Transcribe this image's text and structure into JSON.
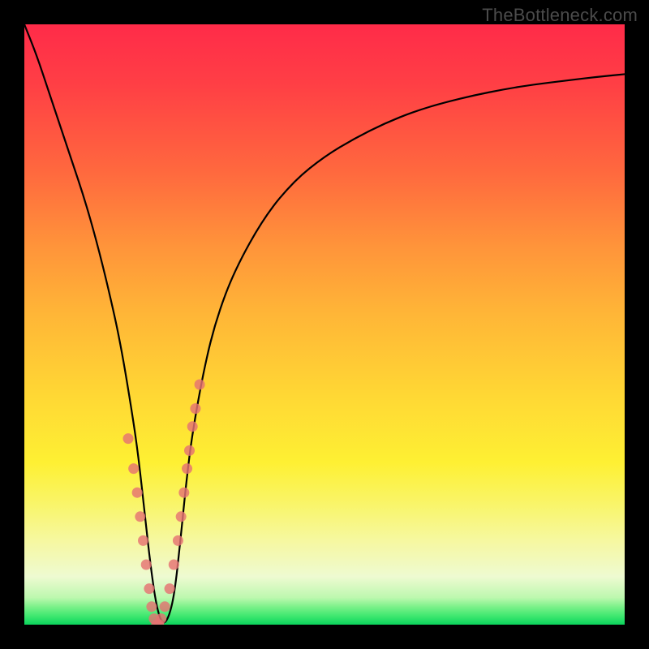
{
  "attribution": "TheBottleneck.com",
  "colors": {
    "frame": "#000000",
    "curve": "#000000",
    "marker_fill": "#e57373",
    "gradient_top": "#ff2b49",
    "gradient_bottom": "#0bd45c"
  },
  "chart_data": {
    "type": "line",
    "title": "",
    "xlabel": "",
    "ylabel": "",
    "xlim": [
      0,
      100
    ],
    "ylim": [
      0,
      100
    ],
    "x": [
      0,
      2,
      4,
      6,
      8,
      10,
      12,
      14,
      16,
      18,
      19,
      20,
      21,
      22,
      23,
      24,
      25,
      26,
      27,
      28,
      30,
      32,
      35,
      40,
      45,
      50,
      55,
      60,
      65,
      70,
      75,
      80,
      85,
      90,
      95,
      100
    ],
    "y": [
      100,
      95,
      89,
      83,
      77,
      71,
      64,
      56,
      47,
      35,
      28,
      19,
      10,
      3,
      0,
      1,
      5,
      14,
      24,
      32,
      43,
      51,
      59,
      68,
      74,
      78,
      81,
      83.5,
      85.5,
      87,
      88.2,
      89.2,
      90,
      90.6,
      91.2,
      91.7
    ],
    "markers": {
      "x": [
        17.3,
        18.2,
        18.8,
        19.3,
        19.8,
        20.3,
        20.8,
        21.2,
        21.6,
        22.0,
        22.4,
        22.8,
        23.4,
        24.2,
        24.9,
        25.6,
        26.1,
        26.6,
        27.1,
        27.5,
        28.0,
        28.5,
        29.2
      ],
      "y": [
        31,
        26,
        22,
        18,
        14,
        10,
        6,
        3,
        1,
        0,
        0,
        1,
        3,
        6,
        10,
        14,
        18,
        22,
        26,
        29,
        33,
        36,
        40
      ]
    },
    "notes": "V-shaped bottleneck curve; y represents bottleneck/mismatch percentage (0 at the optimum around x≈23); x is a normalized component-ratio axis; no numeric axes are rendered in the image."
  }
}
